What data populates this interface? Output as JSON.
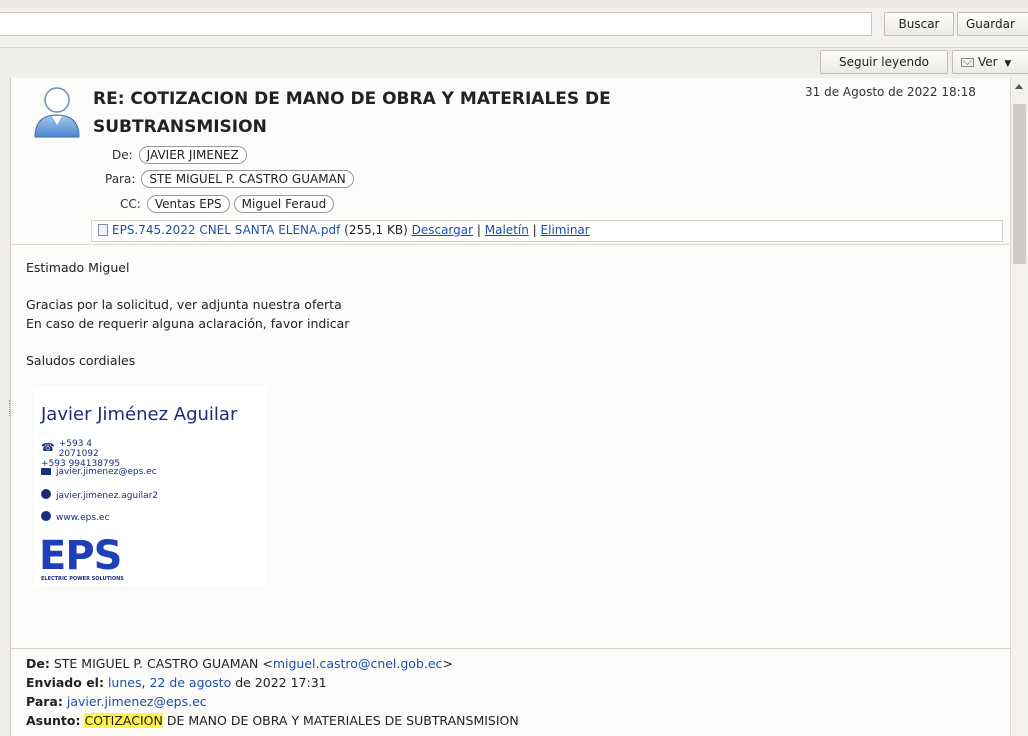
{
  "toolbar": {
    "search_value": "",
    "buscar_label": "Buscar",
    "guardar_label": "Guardar"
  },
  "subtoolbar": {
    "seguir_label": "Seguir leyendo",
    "ver_label": "Ver"
  },
  "message": {
    "subject": "RE: COTIZACION DE MANO DE OBRA Y MATERIALES DE SUBTRANSMISION",
    "date": "31 de Agosto de 2022 18:18",
    "from_label": "De:",
    "from": "JAVIER JIMENEZ",
    "to_label": "Para:",
    "to": "STE MIGUEL P. CASTRO GUAMAN",
    "cc_label": "CC:",
    "cc": [
      "Ventas EPS",
      "Miguel Feraud"
    ],
    "attachment": {
      "name": "EPS.745.2022 CNEL SANTA ELENA.pdf",
      "size": "(255,1 KB)",
      "download": "Descargar",
      "sep": "|",
      "briefcase": "Maletín",
      "delete": "Eliminar"
    },
    "body_lines": [
      "Estimado Miguel",
      "Gracias por la solicitud, ver adjunta nuestra oferta",
      "En caso de requerir alguna aclaración, favor indicar",
      "Saludos cordiales"
    ],
    "signature": {
      "name": "Javier Jiménez Aguilar",
      "phone1": "+593 4 2071092",
      "phone2": "+593  994138795",
      "email": "javier.jimenez@eps.ec",
      "skype": "javier.jimenez.aguilar2",
      "web": "www.eps.ec",
      "logo": "EPS",
      "logo_tag": "ELECTRIC POWER SOLUTIONS"
    },
    "forwarded": {
      "from_label": "De:",
      "from_name": "STE MIGUEL P. CASTRO GUAMAN <",
      "from_email": "miguel.castro@cnel.gob.ec",
      "from_close": ">",
      "sent_label": "Enviado el:",
      "sent_day": "lunes",
      "sent_comma": ",",
      "sent_date": "22 de agosto",
      "sent_rest": "de 2022 17:31",
      "to_label": "Para:",
      "to": "javier.jimenez@eps.ec",
      "subject_label": "Asunto:",
      "subject_hl": "COTIZACION",
      "subject_rest": " DE MANO DE OBRA Y MATERIALES DE SUBTRANSMISION"
    }
  }
}
